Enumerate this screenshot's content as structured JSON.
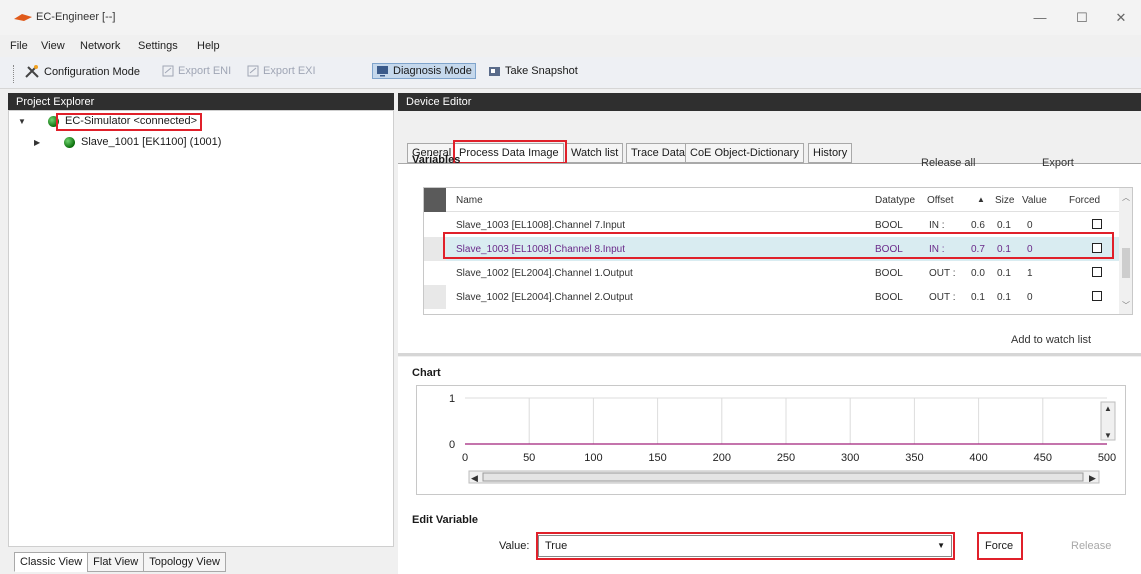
{
  "window": {
    "title": "EC-Engineer [--]",
    "minimize": "—",
    "maximize": "☐",
    "close": "✕"
  },
  "menu": [
    "File",
    "View",
    "Network",
    "Settings",
    "Help"
  ],
  "toolbar": {
    "configuration_mode": "Configuration Mode",
    "export_eni": "Export ENI",
    "export_exi": "Export EXI",
    "diagnosis_mode": "Diagnosis Mode",
    "take_snapshot": "Take Snapshot"
  },
  "project_explorer": {
    "header": "Project Explorer",
    "root": "EC-Simulator <connected>",
    "child": "Slave_1001 [EK1100] (1001)",
    "view_tabs": [
      "Classic View",
      "Flat View",
      "Topology View"
    ]
  },
  "device_editor": {
    "header": "Device Editor",
    "tabs": [
      "General",
      "Process Data Image",
      "Watch list",
      "Trace Data",
      "CoE Object-Dictionary",
      "History"
    ],
    "active_tab": "Process Data Image",
    "variables": {
      "title": "Variables",
      "release_all": "Release all",
      "export": "Export",
      "add_to_watch_list": "Add to watch list",
      "columns": {
        "name": "Name",
        "datatype": "Datatype",
        "offset": "Offset",
        "sort": "▲",
        "size": "Size",
        "value": "Value",
        "forced": "Forced"
      },
      "rows": [
        {
          "name": "Slave_1003 [EL1008].Channel 7.Input",
          "datatype": "BOOL",
          "dir": "IN :",
          "offset": "0.6",
          "size": "0.1",
          "value": "0",
          "selected": false
        },
        {
          "name": "Slave_1003 [EL1008].Channel 8.Input",
          "datatype": "BOOL",
          "dir": "IN :",
          "offset": "0.7",
          "size": "0.1",
          "value": "0",
          "selected": true
        },
        {
          "name": "Slave_1002 [EL2004].Channel 1.Output",
          "datatype": "BOOL",
          "dir": "OUT :",
          "offset": "0.0",
          "size": "0.1",
          "value": "1",
          "selected": false
        },
        {
          "name": "Slave_1002 [EL2004].Channel 2.Output",
          "datatype": "BOOL",
          "dir": "OUT :",
          "offset": "0.1",
          "size": "0.1",
          "value": "0",
          "selected": false
        }
      ]
    },
    "chart": {
      "title": "Chart",
      "y_ticks": [
        "1",
        "0"
      ],
      "x_ticks": [
        "0",
        "50",
        "100",
        "150",
        "200",
        "250",
        "300",
        "350",
        "400",
        "450",
        "500"
      ],
      "series_value": 0,
      "line_color": "#a0207a"
    },
    "edit_variable": {
      "title": "Edit Variable",
      "value_label": "Value:",
      "value": "True",
      "force": "Force",
      "release": "Release"
    }
  },
  "colors": {
    "highlight_red": "#e0202a",
    "selected_row": "#d9ecf1",
    "panel_header": "#2f2f2f"
  }
}
